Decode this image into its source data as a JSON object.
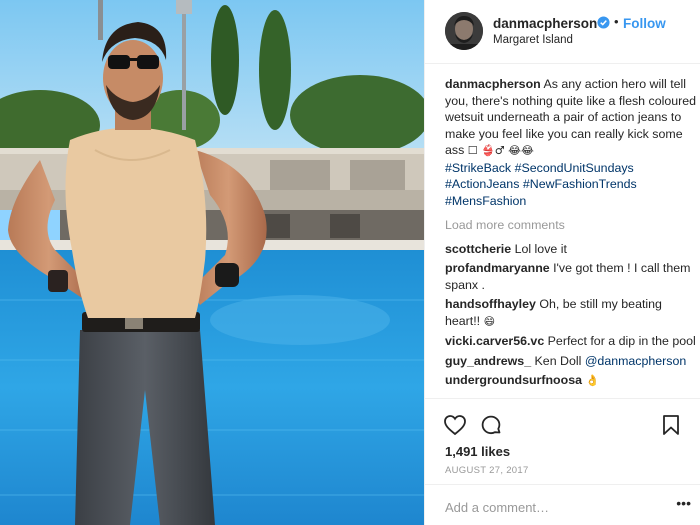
{
  "post": {
    "username": "danmacpherson",
    "location": "Margaret Island",
    "follow_label": "Follow",
    "dot": "•",
    "caption": {
      "username": "danmacpherson",
      "text": "As any action hero will tell you, there's nothing quite like a flesh coloured wetsuit underneath a pair of action jeans to make you feel like you can really kick some ass",
      "emoji": "☐ 👙♂ 😂😂",
      "hashtags": [
        "#StrikeBack",
        "#SecondUnitSundays",
        "#ActionJeans",
        "#NewFashionTrends",
        "#MensFashion"
      ]
    },
    "load_more": "Load more comments",
    "comments": [
      {
        "username": "scottcherie",
        "text": "Lol love it"
      },
      {
        "username": "profandmaryanne",
        "text": "I've got them ! I call them spanx ."
      },
      {
        "username": "handsoffhayley",
        "text": "Oh, be still my beating heart!!",
        "emoji": "😄"
      },
      {
        "username": "vicki.carver56.vc",
        "text": "Perfect for a dip in the pool"
      },
      {
        "username": "guy_andrews_",
        "text": "Ken Doll",
        "mention": "@danmacpherson"
      },
      {
        "username": "undergroundsurfnoosa",
        "text": "",
        "emoji": "👌"
      }
    ],
    "likes": "1,491 likes",
    "date": "AUGUST 27, 2017",
    "add_comment_placeholder": "Add a comment…",
    "more_label": "•••"
  },
  "colors": {
    "link_blue": "#3897f0",
    "hashtag": "#003569",
    "muted": "#999999",
    "text": "#262626",
    "verified": "#3897f0"
  },
  "icons": [
    "verified-badge-icon",
    "heart-icon",
    "comment-icon",
    "bookmark-icon",
    "more-options-icon"
  ]
}
